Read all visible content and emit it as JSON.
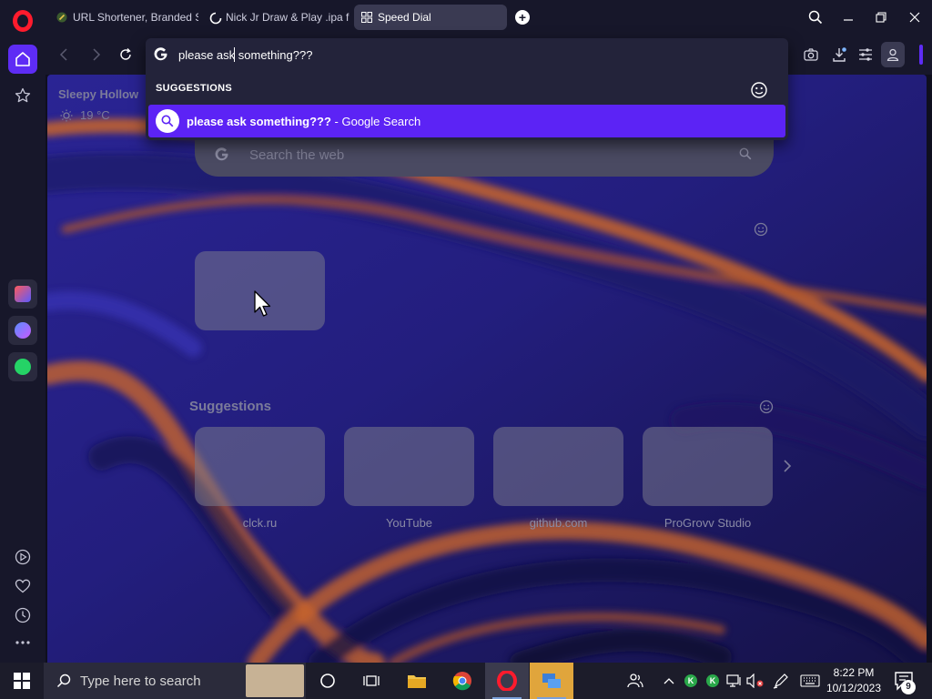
{
  "browser": {
    "tabs": [
      {
        "title": "URL Shortener, Branded S",
        "icon": "link-favicon-icon",
        "active": false
      },
      {
        "title": "Nick Jr Draw & Play .ipa f",
        "icon": "loading-icon",
        "active": false
      },
      {
        "title": "Speed Dial",
        "icon": "speed-dial-icon",
        "active": true
      }
    ],
    "new_tab_label": "+",
    "address": {
      "value": "please ask something???",
      "suggestions_header": "SUGGESTIONS",
      "suggestion": {
        "query": "please ask something???",
        "suffix": " - Google Search"
      }
    }
  },
  "speed_dial": {
    "weather": {
      "location": "Sleepy Hollow",
      "temperature": "19 °C"
    },
    "search": {
      "placeholder": "Search the web"
    },
    "suggestions_title": "Suggestions",
    "suggestion_tiles": [
      {
        "label": "clck.ru"
      },
      {
        "label": "YouTube"
      },
      {
        "label": "github.com"
      },
      {
        "label": "ProGrovv Studio"
      }
    ]
  },
  "taskbar": {
    "search_placeholder": "Type here to search",
    "clock_time": "8:22 PM",
    "clock_date": "10/12/2023",
    "notification_count": "9",
    "tray_k1": "K",
    "tray_k2": "K"
  },
  "colors": {
    "accent": "#5c23f5",
    "opera_red": "#ff1b2d",
    "wallpaper_orange": "#c8642a",
    "wallpaper_blue": "#3a2fb8"
  }
}
